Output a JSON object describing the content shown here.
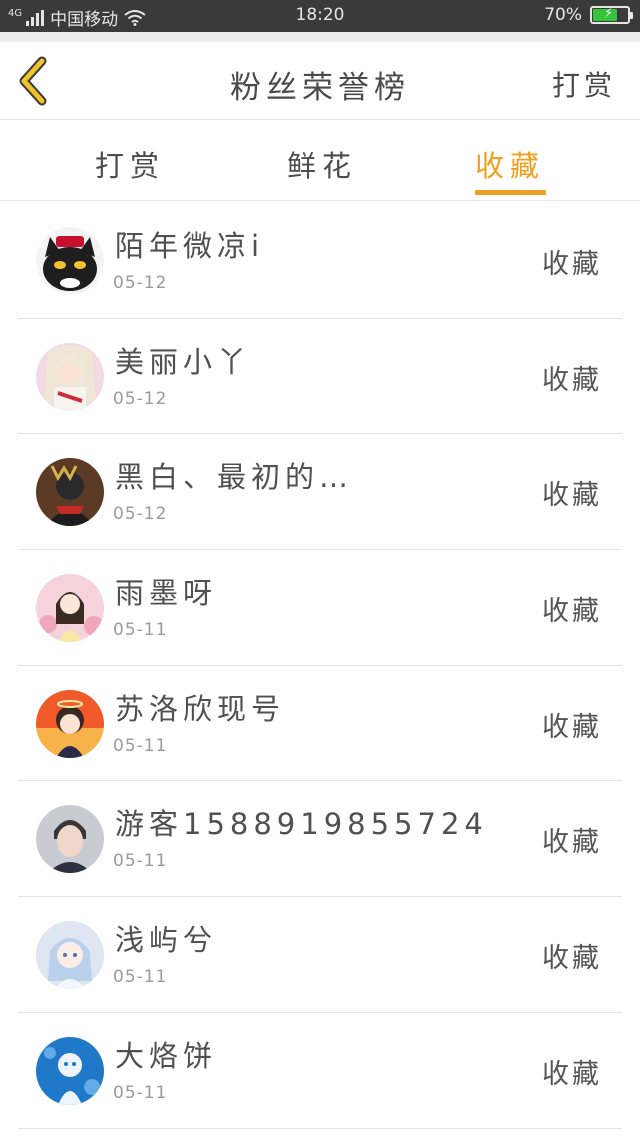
{
  "status_bar": {
    "network": "4G",
    "carrier": "中国移动",
    "time": "18:20",
    "battery": "70%",
    "battery_level": 0.7,
    "battery_color": "#36c53a"
  },
  "header": {
    "title": "粉丝荣誉榜",
    "action": "打赏",
    "back_icon": "chevron-left-icon",
    "accent_color": "#f0a020"
  },
  "tabs": [
    {
      "label": "打赏",
      "active": false
    },
    {
      "label": "鲜花",
      "active": false
    },
    {
      "label": "收藏",
      "active": true
    }
  ],
  "fans": [
    {
      "name": "陌年微凉i",
      "date": "05-12",
      "action": "收藏"
    },
    {
      "name": "美丽小丫",
      "date": "05-12",
      "action": "收藏"
    },
    {
      "name": "黑白、最初的…",
      "date": "05-12",
      "action": "收藏"
    },
    {
      "name": "雨墨呀",
      "date": "05-11",
      "action": "收藏"
    },
    {
      "name": "苏洛欣现号",
      "date": "05-11",
      "action": "收藏"
    },
    {
      "name": "游客15889198557​24",
      "date": "05-11",
      "action": "收藏"
    },
    {
      "name": "浅屿兮",
      "date": "05-11",
      "action": "收藏"
    },
    {
      "name": "大烙饼",
      "date": "05-11",
      "action": "收藏"
    }
  ]
}
